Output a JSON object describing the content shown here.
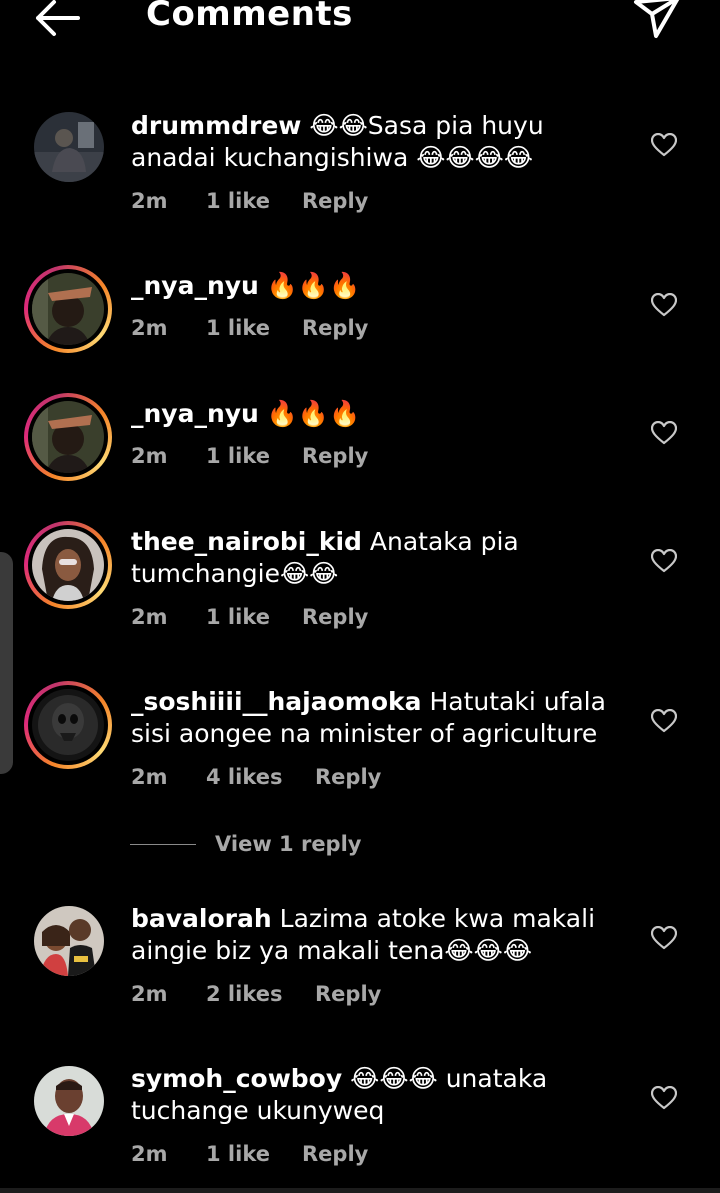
{
  "header": {
    "title": "Comments",
    "back_icon": "arrow-left-icon",
    "send_icon": "paper-plane-icon"
  },
  "comments": [
    {
      "username": "drummdrew",
      "text_line1": " 😂😂Sasa pia huyu",
      "text_line2": "anadai kuchangishiwa 😂😂😂😂",
      "time": "2m",
      "likes": "1 like",
      "reply": "Reply"
    },
    {
      "username": "_nya_nyu",
      "text_line1": " 🔥🔥🔥",
      "time": "2m",
      "likes": "1 like",
      "reply": "Reply"
    },
    {
      "username": "_nya_nyu",
      "text_line1": " 🔥🔥🔥",
      "time": "2m",
      "likes": "1 like",
      "reply": "Reply"
    },
    {
      "username": "thee_nairobi_kid",
      "text_line1": " Anataka pia",
      "text_line2": "tumchangie😂😂",
      "time": "2m",
      "likes": "1 like",
      "reply": "Reply"
    },
    {
      "username": "_soshiiii__hajaomoka",
      "text_line1": " Hatutaki ufala",
      "text_line2": "sisi aongee na minister of agriculture",
      "time": "2m",
      "likes": "4 likes",
      "reply": "Reply"
    },
    {
      "username": "bavalorah",
      "text_line1": " Lazima atoke kwa makali",
      "text_line2": "aingie biz ya makali tena😂😂😂",
      "time": "2m",
      "likes": "2 likes",
      "reply": "Reply"
    },
    {
      "username": "symoh_cowboy",
      "text_line1": " 😂😂😂 unataka",
      "text_line2": "tuchange ukunyweq",
      "time": "2m",
      "likes": "1 like",
      "reply": "Reply"
    }
  ],
  "view_replies": "View 1 reply",
  "colors": {
    "background": "#000000",
    "text": "#ffffff",
    "meta": "#a8a8a8",
    "story_ring_start": "#f58529",
    "story_ring_end": "#dd2a7b"
  }
}
